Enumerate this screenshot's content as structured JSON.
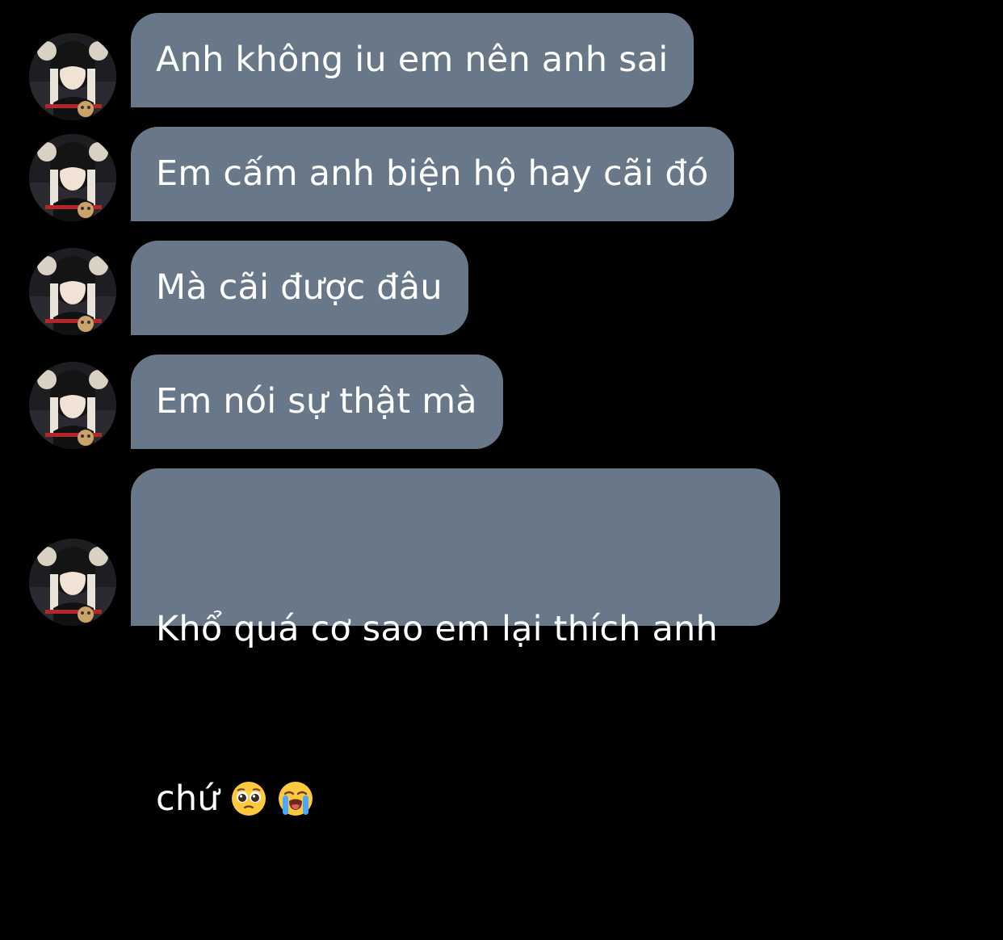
{
  "messages": [
    {
      "text": "Anh không iu em nên anh sai",
      "avatar_icon": "user-avatar-icon"
    },
    {
      "text": "Em cấm anh biện hộ hay cãi đó",
      "avatar_icon": "user-avatar-icon"
    },
    {
      "text": "Mà cãi được đâu",
      "avatar_icon": "user-avatar-icon"
    },
    {
      "text": "Em nói sự thật mà",
      "avatar_icon": "user-avatar-icon"
    },
    {
      "text_line1": "Khổ quá cơ sao em lại thích anh",
      "text_line2": "chứ",
      "emojis": [
        "pleading-face-emoji",
        "loudly-crying-face-emoji"
      ],
      "avatar_icon": "user-avatar-icon"
    }
  ],
  "colors": {
    "background": "#000000",
    "bubble": "#687888",
    "text": "#ffffff"
  }
}
